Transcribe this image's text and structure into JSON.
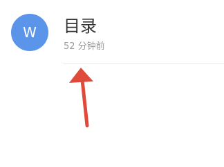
{
  "item": {
    "avatar_letter": "W",
    "title": "目录",
    "time": "52 分钟前"
  },
  "icons": {
    "avatar": "wps-app-icon",
    "annotation": "red-arrow-icon"
  },
  "colors": {
    "avatar_bg": "#5b95ea",
    "arrow": "#e04a3b"
  }
}
